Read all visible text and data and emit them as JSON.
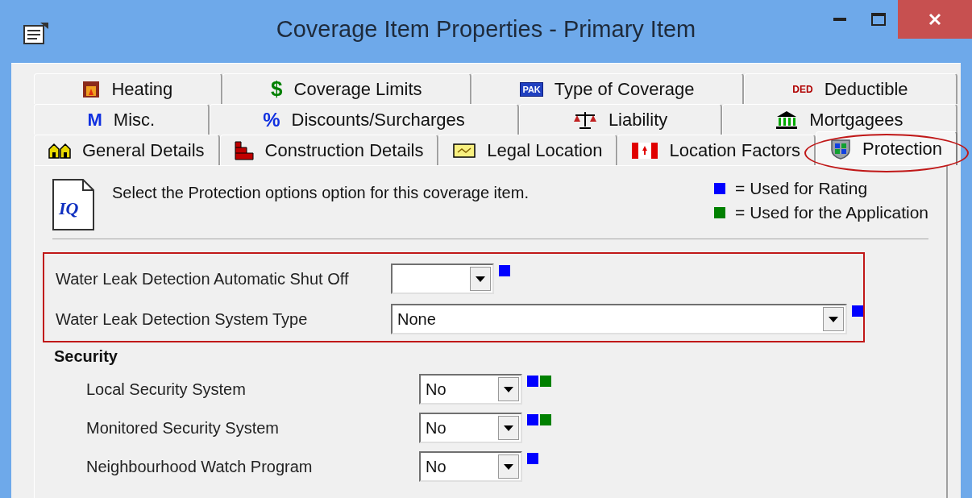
{
  "window": {
    "title": "Coverage Item Properties - Primary Item"
  },
  "tab_rows": [
    [
      {
        "label": "Heating",
        "selected": false
      },
      {
        "label": "Coverage Limits",
        "glyph": "$",
        "selected": false
      },
      {
        "label": "Type of Coverage",
        "glyph": "PAK",
        "selected": false
      },
      {
        "label": "Deductible",
        "glyph": "DED",
        "selected": false
      }
    ],
    [
      {
        "label": "Misc.",
        "glyph": "M",
        "selected": false
      },
      {
        "label": "Discounts/Surcharges",
        "glyph": "%",
        "selected": false
      },
      {
        "label": "Liability",
        "selected": false
      },
      {
        "label": "Mortgagees",
        "selected": false
      }
    ],
    [
      {
        "label": "General Details",
        "selected": false
      },
      {
        "label": "Construction Details",
        "selected": false
      },
      {
        "label": "Legal Location",
        "selected": false
      },
      {
        "label": "Location Factors",
        "selected": false
      },
      {
        "label": "Protection",
        "selected": true,
        "circled": true
      }
    ]
  ],
  "panel": {
    "doc_icon_text": "IQ",
    "instruction": "Select the Protection options option for this coverage item.",
    "legend": [
      {
        "color": "#0000ff",
        "label": "= Used for Rating"
      },
      {
        "color": "#008000",
        "label": "= Used for the Application"
      }
    ],
    "groups": [
      {
        "highlighted": true,
        "fields": [
          {
            "label": "Water Leak Detection Automatic Shut Off",
            "rating": true,
            "application": false
          },
          {
            "label": "Water Leak Detection System Type",
            "value": "None",
            "rating": true,
            "application": false
          }
        ]
      },
      {
        "highlighted": false,
        "title": "Security",
        "fields": [
          {
            "label": "Local Security System",
            "value": "No",
            "rating": true,
            "application": true
          },
          {
            "label": "Monitored Security System",
            "value": "No",
            "rating": true,
            "application": true
          },
          {
            "label": "Neighbourhood Watch Program",
            "value": "No",
            "rating": true,
            "application": false
          }
        ]
      }
    ]
  }
}
